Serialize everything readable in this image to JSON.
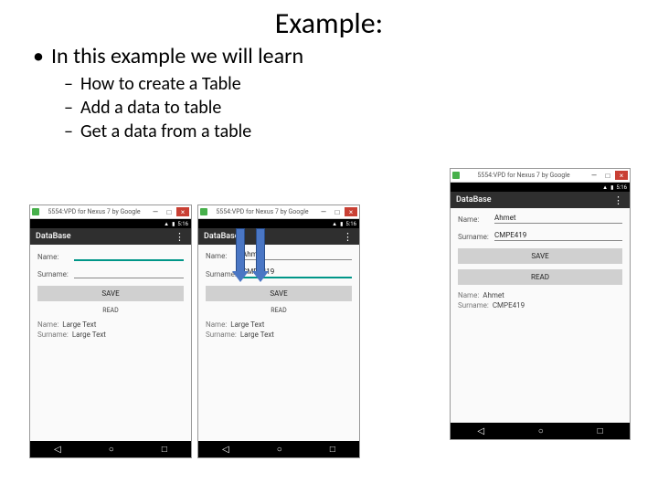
{
  "title": "Example:",
  "lvl1_text": "In this example we will learn",
  "lvl2": [
    "How to create a Table",
    "Add a data to table",
    "Get a data from a table"
  ],
  "emu_title": "5554:VPD for Nexus 7 by Google",
  "app_title": "DataBase",
  "status_time": "5:16",
  "labels": {
    "name": "Name:",
    "surname": "Surname:"
  },
  "placeholders": {
    "large_text": "Large Text"
  },
  "btn_save": "SAVE",
  "btn_read": "READ",
  "counter": "READ",
  "phone1": {
    "name_value": "",
    "surname_value": "",
    "out_name": "Large Text",
    "out_surname": "Large Text"
  },
  "phone2": {
    "name_value": "Ahmet",
    "surname_value": "CMPE419",
    "out_name": "Large Text",
    "out_surname": "Large Text"
  },
  "phone3": {
    "name_value": "Ahmet",
    "surname_value": "CMPE419",
    "out_name": "Ahmet",
    "out_surname": "CMPE419"
  },
  "win": {
    "min": "—",
    "max": "□",
    "close": "×"
  },
  "nav": {
    "back": "◁",
    "home": "○",
    "recent": "□"
  }
}
